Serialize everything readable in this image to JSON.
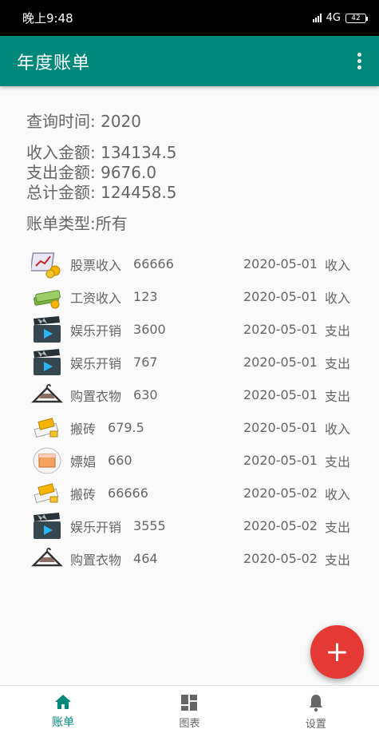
{
  "status_bar": {
    "time": "晚上9:48",
    "network": "4G",
    "battery": "42"
  },
  "app_bar": {
    "title": "年度账单"
  },
  "summary": {
    "query_time": "查询时间: 2020",
    "income": "收入金额: 134134.5",
    "expense": "支出金额: 9676.0",
    "total": "总计金额: 124458.5",
    "bill_type": "账单类型:所有"
  },
  "records": [
    {
      "icon": "stock-chart-icon",
      "name": "股票收入",
      "amount": "66666",
      "date": "2020-05-01",
      "kind": "收入"
    },
    {
      "icon": "money-stack-icon",
      "name": "工资收入",
      "amount": "123",
      "date": "2020-05-01",
      "kind": "收入"
    },
    {
      "icon": "clapperboard-icon",
      "name": "娱乐开销",
      "amount": "3600",
      "date": "2020-05-01",
      "kind": "支出"
    },
    {
      "icon": "clapperboard-icon",
      "name": "娱乐开销",
      "amount": "767",
      "date": "2020-05-01",
      "kind": "支出"
    },
    {
      "icon": "clothes-hanger-icon",
      "name": "购置衣物",
      "amount": "630",
      "date": "2020-05-01",
      "kind": "支出"
    },
    {
      "icon": "bricks-icon",
      "name": "搬砖",
      "amount": "679.5",
      "date": "2020-05-01",
      "kind": "收入"
    },
    {
      "icon": "box-icon",
      "name": "嫖娼",
      "amount": "660",
      "date": "2020-05-01",
      "kind": "支出"
    },
    {
      "icon": "bricks-icon",
      "name": "搬砖",
      "amount": "66666",
      "date": "2020-05-02",
      "kind": "收入"
    },
    {
      "icon": "clapperboard-icon",
      "name": "娱乐开销",
      "amount": "3555",
      "date": "2020-05-02",
      "kind": "支出"
    },
    {
      "icon": "clothes-hanger-icon",
      "name": "购置衣物",
      "amount": "464",
      "date": "2020-05-02",
      "kind": "支出"
    }
  ],
  "fab": {
    "label": "+"
  },
  "bottom_nav": [
    {
      "label": "账单",
      "icon": "home-icon",
      "active": true
    },
    {
      "label": "图表",
      "icon": "grid-icon",
      "active": false
    },
    {
      "label": "设置",
      "icon": "bell-icon",
      "active": false
    }
  ],
  "colors": {
    "primary": "#00897b",
    "fab": "#e53935",
    "text": "#666666"
  }
}
